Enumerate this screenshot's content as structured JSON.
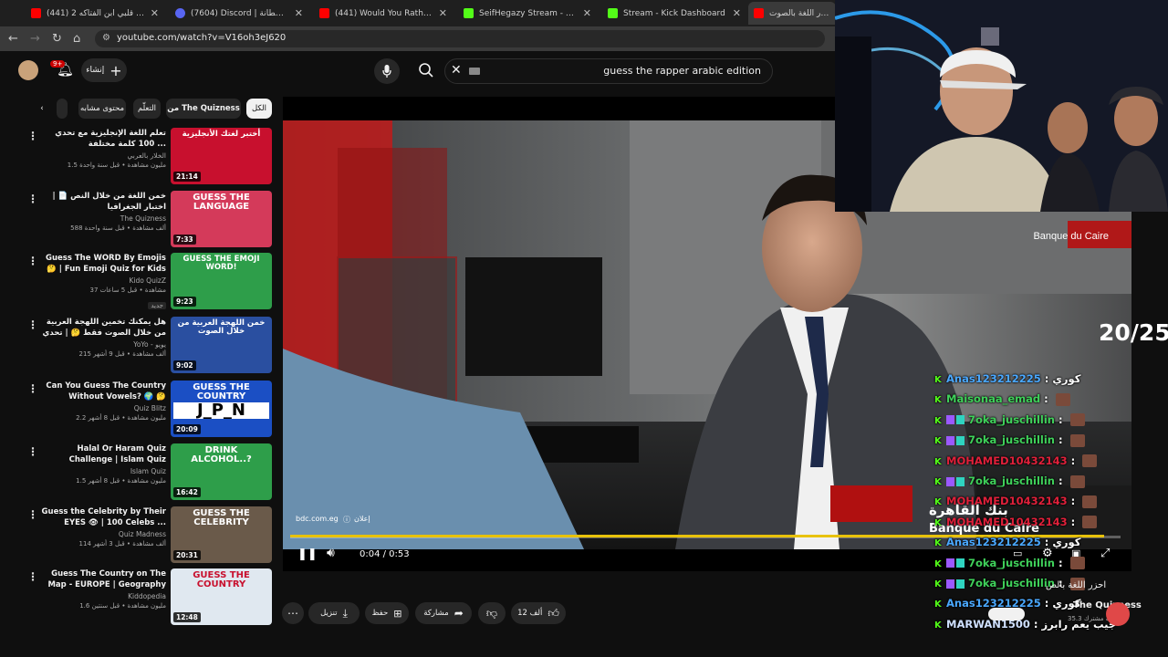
{
  "browser": {
    "tabs": [
      {
        "title": "(441) انا قلبي ابن الفتاكه 2 - Tube",
        "color": "#ff0000"
      },
      {
        "title": "(7604) Discord | شطانة@",
        "color": "#5865f2"
      },
      {
        "title": "(441) Would You Rather...? 140",
        "color": "#ff0000"
      },
      {
        "title": "SeifHegazy Stream - Watch Live",
        "color": "#53fc18"
      },
      {
        "title": "Stream - Kick Dashboard",
        "color": "#53fc18"
      },
      {
        "title": "احزر اللغة بالصوت",
        "color": "#ff0000"
      }
    ],
    "url": "youtube.com/watch?v=V16oh3eJ620"
  },
  "header": {
    "create_label": "إنشاء",
    "notif_count": "9+",
    "search_query": "guess the rapper arabic edition"
  },
  "chips": [
    "الكل",
    "من The Quizness",
    "التعلّم",
    "محتوى مشابه"
  ],
  "recommendations": [
    {
      "title": "تعلم اللغة الإنجليزية مع تحدي 100 كلمة مختلفة ...",
      "channel": "الخلار بالعربي",
      "meta": "1.5 مليون مشاهدة • قبل سنة واحدة",
      "duration": "21:14",
      "thumb_text": "أختبر لغتك الأنجليزية",
      "thumb_color": "#c8102e"
    },
    {
      "title": "خمن اللغة من خلال النص 📄 | اختبار الجغرافيا",
      "channel": "The Quizness",
      "meta": "588 ألف مشاهدة • قبل سنة واحدة",
      "duration": "7:33",
      "thumb_text": "GUESS THE LANGUAGE",
      "thumb_color": "#d43a5a"
    },
    {
      "title": "Guess The WORD By Emojis 🤔 | Fun Emoji Quiz for Kids",
      "channel": "Kido QuizZ",
      "meta": "37 مشاهدة • قبل 5 ساعات",
      "duration": "9:23",
      "thumb_text": "GUESS THE EMOJI WORD!",
      "thumb_color": "#2e9e4a",
      "badge": "جديد"
    },
    {
      "title": "هل يمكنك تخمين اللهجة العربية من خلال الصوت فقط 🤔 | تحدي اللهجات ...",
      "channel": "YoYo - يويو",
      "meta": "215 ألف مشاهدة • قبل 9 أشهر",
      "duration": "9:02",
      "thumb_text": "خمن اللهجة العربية من خلال الصوت",
      "thumb_color": "#2a4fa0"
    },
    {
      "title": "Can You Guess The Country Without Vowels? 🌍 🤔 Country ...",
      "channel": "Quiz Blitz",
      "meta": "2.2 مليون مشاهدة • قبل 8 أشهر",
      "duration": "20:09",
      "thumb_text": "GUESS THE COUNTRY",
      "thumb_color": "#1b4fc4",
      "thumb_sub": "J_P_N"
    },
    {
      "title": "Halal Or Haram Quiz Challenge | Islam Quiz",
      "channel": "Islam Quiz",
      "meta": "1.5 مليون مشاهدة • قبل 8 أشهر",
      "duration": "16:42",
      "thumb_text": "DRINK ALCOHOL..?",
      "thumb_color": "#2e9e4a"
    },
    {
      "title": "Guess the Celebrity by Their EYES 👁 | 100 Celebs ...",
      "channel": "Quiz Madness",
      "meta": "114 ألف مشاهدة • قبل 3 أشهر",
      "duration": "20:31",
      "thumb_text": "GUESS THE CELEBRITY",
      "thumb_color": "#6a5a4a"
    },
    {
      "title": "Guess The Country on The Map - EUROPE | Geography Quiz ...",
      "channel": "Kiddopedia",
      "meta": "1.6 مليون مشاهدة • قبل سنتين",
      "duration": "12:48",
      "thumb_text": "GUESS THE COUNTRY",
      "thumb_color": "#e0e8f0"
    }
  ],
  "player": {
    "ad_domain": "bdc.com.eg",
    "ad_label": "إعلان",
    "time": "0:04 / 0:53",
    "bank_name": "بنك القاهرة",
    "bank_latin": "Banque du Caire",
    "progress": 0.98
  },
  "actions": {
    "like_count": "12 ألف",
    "share": "مشاركة",
    "save": "حفظ",
    "download": "تنزيل"
  },
  "overlay": {
    "counter": "20/25",
    "chat": [
      {
        "user": "Anas123212225",
        "text": "كوري",
        "color": "#4aa8ff",
        "badges": false
      },
      {
        "user": "Maisonaa_emad",
        "text": "",
        "color": "#3fd15a",
        "badges": false,
        "emote": true
      },
      {
        "user": "7oka_juschillin",
        "text": "",
        "color": "#3fd15a",
        "badges": true,
        "emote": true
      },
      {
        "user": "7oka_juschillin",
        "text": "",
        "color": "#3fd15a",
        "badges": true,
        "emote": true
      },
      {
        "user": "MOHAMED10432143",
        "text": "",
        "color": "#e0203a",
        "badges": false,
        "emote": true
      },
      {
        "user": "7oka_juschillin",
        "text": "",
        "color": "#3fd15a",
        "badges": true,
        "emote": true
      },
      {
        "user": "MOHAMED10432143",
        "text": "",
        "color": "#e0203a",
        "badges": false,
        "emote": true
      },
      {
        "user": "MOHAMED10432143",
        "text": "",
        "color": "#e0203a",
        "badges": false,
        "emote": true
      },
      {
        "user": "Anas123212225",
        "text": "كوري",
        "color": "#4aa8ff",
        "badges": false
      },
      {
        "user": "7oka_juschillin",
        "text": "",
        "color": "#3fd15a",
        "badges": true,
        "emote": true
      },
      {
        "user": "7oka_juschillin",
        "text": "",
        "color": "#3fd15a",
        "badges": true,
        "emote": true
      },
      {
        "user": "Anas123212225",
        "text": "كوري",
        "color": "#4aa8ff",
        "badges": false
      },
      {
        "user": "MARWAN1500",
        "text": "جيب يعم رابرز",
        "color": "#cfe0ff",
        "badges": false
      }
    ],
    "channel_name": "The Quizness",
    "subs": "35.3 ألف مشترك",
    "video_title_partial": "احزر اللغة بالص"
  }
}
